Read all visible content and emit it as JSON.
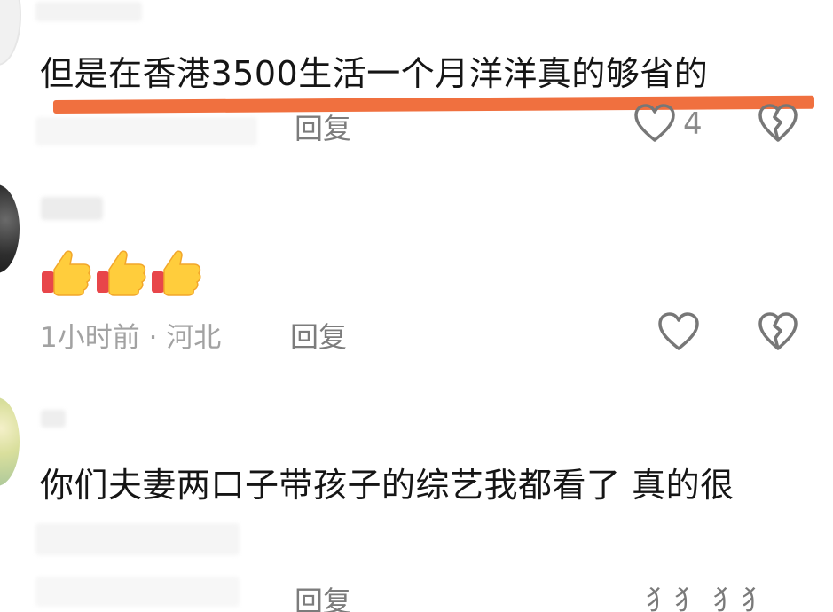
{
  "comments": [
    {
      "text": "但是在香港3500生活一个月洋洋真的够省的",
      "reply_label": "回复",
      "like_count": "4"
    },
    {
      "emoji": [
        "thumbs-up",
        "thumbs-up",
        "thumbs-up"
      ],
      "meta": "1小时前 · 河北",
      "reply_label": "回复"
    },
    {
      "text": "你们夫妻两口子带孩子的综艺我都看了 真的很",
      "reply_label": "回复",
      "tail_text": "犭犭  犭犭"
    }
  ],
  "icons": {
    "like": "heart-outline-icon",
    "dislike": "broken-heart-icon"
  },
  "colors": {
    "highlight_line": "#f0703f",
    "icon_stroke": "#777777"
  }
}
